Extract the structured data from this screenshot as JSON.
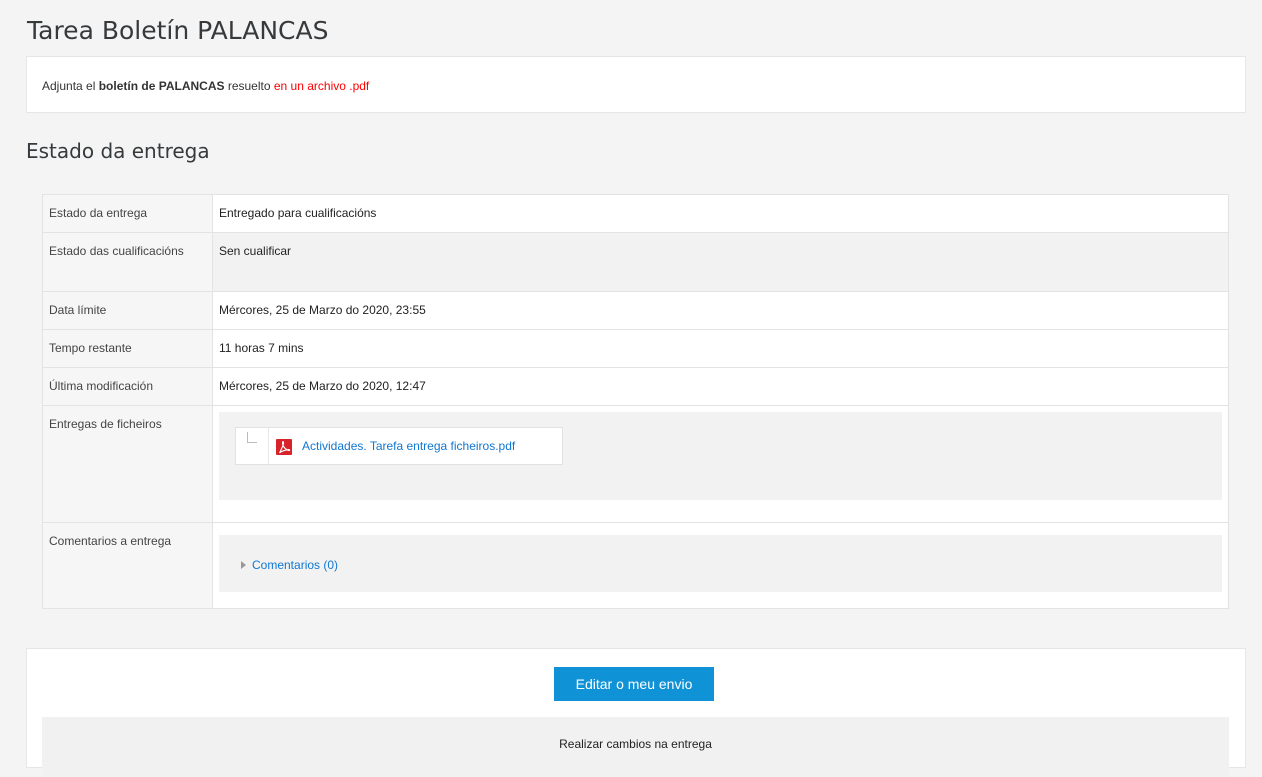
{
  "page": {
    "title": "Tarea Boletín PALANCAS"
  },
  "intro": {
    "prefix": "Adjunta el ",
    "bold": "boletín de PALANCAS",
    "middle": " resuelto ",
    "red": "en un archivo .pdf"
  },
  "section": {
    "title": "Estado da entrega"
  },
  "table": {
    "rows": [
      {
        "label": "Estado da entrega",
        "value": "Entregado para cualificacións"
      },
      {
        "label": "Estado das cualificacións",
        "value": "Sen cualificar"
      },
      {
        "label": "Data límite",
        "value": "Mércores, 25 de Marzo do 2020, 23:55"
      },
      {
        "label": "Tempo restante",
        "value": "11 horas 7 mins"
      },
      {
        "label": "Última modificación",
        "value": "Mércores, 25 de Marzo do 2020, 12:47"
      },
      {
        "label": "Entregas de ficheiros",
        "file_name": "Actividades. Tarefa entrega ficheiros.pdf",
        "file_icon": "pdf-icon"
      },
      {
        "label": "Comentarios a entrega",
        "comments_link": "Comentarios (0)"
      }
    ]
  },
  "actions": {
    "edit_button": "Editar o meu envio",
    "help_text": "Realizar cambios na entrega"
  },
  "colors": {
    "accent": "#0f92d6",
    "link": "#1177d1",
    "highlight_red": "#ff0000",
    "pdf_red": "#d8232a"
  }
}
